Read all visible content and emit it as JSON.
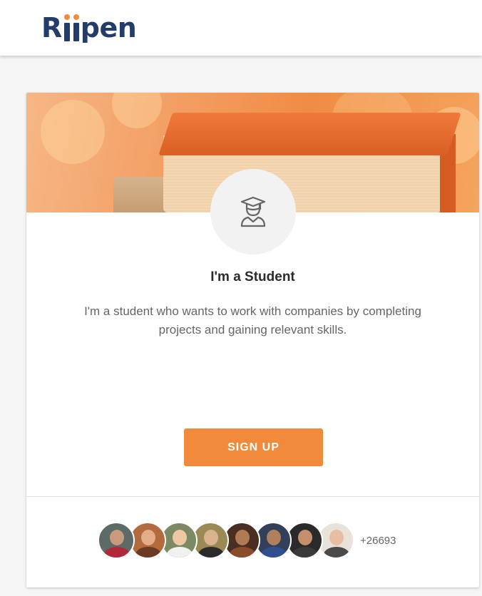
{
  "header": {
    "logo": "Riipen"
  },
  "card": {
    "icon": "student-graduate-icon",
    "title": "I'm a Student",
    "description": "I'm a student who wants to work with companies by completing projects and gaining  relevant skills.",
    "signup_label": "SIGN UP",
    "members_count": "+26693",
    "avatars": [
      {
        "bg": "#5d6b66",
        "skin": "#c99a7e",
        "shirt": "#b0283a"
      },
      {
        "bg": "#b36a3c",
        "skin": "#e2ad88",
        "shirt": "#6b3a22"
      },
      {
        "bg": "#7c8a63",
        "skin": "#eec7a3",
        "shirt": "#f0f0f0"
      },
      {
        "bg": "#9a8a55",
        "skin": "#d9b28f",
        "shirt": "#2b2b2b"
      },
      {
        "bg": "#4b2e22",
        "skin": "#b07a55",
        "shirt": "#8a4d2a"
      },
      {
        "bg": "#32405a",
        "skin": "#b07f5c",
        "shirt": "#2f4f8f"
      },
      {
        "bg": "#2a2a2a",
        "skin": "#c48f6a",
        "shirt": "#3a3a3a"
      },
      {
        "bg": "#e9e2d8",
        "skin": "#e6bea2",
        "shirt": "#4a4a4a"
      }
    ]
  },
  "colors": {
    "accent": "#f28a3b",
    "brand": "#243c6a"
  }
}
